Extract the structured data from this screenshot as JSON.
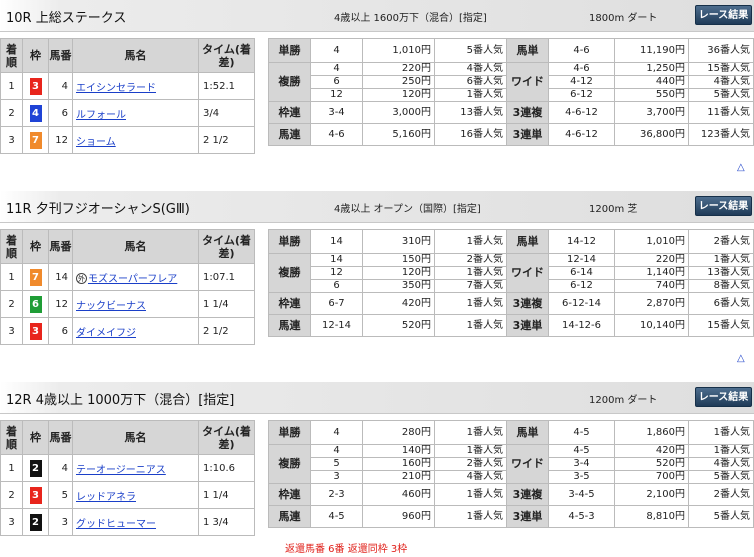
{
  "race_button_label": "レース結果",
  "colors": {
    "waku_1": "#ffffff",
    "waku_2": "#111111",
    "waku_3": "#e8251c",
    "waku_4": "#1f43d6",
    "waku_6": "#1f9d36",
    "waku_7": "#f08a2c",
    "link": "#1a3fc8",
    "note": "#e0201a"
  },
  "res_headers": [
    "着順",
    "枠",
    "馬番",
    "馬名",
    "タイム(着差)"
  ],
  "races": [
    {
      "title": "10R 上総ステークス",
      "condition": "4歳以上 1600万下（混合）[指定]",
      "distance": "1800m ダート",
      "results": [
        {
          "rank": "1",
          "waku": "3",
          "num": "4",
          "name": "エイシンセラード",
          "time": "1:52.1",
          "foreign": false
        },
        {
          "rank": "2",
          "waku": "4",
          "num": "6",
          "name": "ルフォール",
          "time": "3/4",
          "foreign": false
        },
        {
          "rank": "3",
          "waku": "7",
          "num": "12",
          "name": "ショーム",
          "time": "2 1/2",
          "foreign": false
        }
      ],
      "payouts": {
        "tansho": {
          "label": "単勝",
          "num": "4",
          "yen": "1,010円",
          "pop": "5番人気"
        },
        "fukusho": {
          "label": "複勝",
          "rows": [
            [
              "4",
              "220円",
              "4番人気"
            ],
            [
              "6",
              "250円",
              "6番人気"
            ],
            [
              "12",
              "120円",
              "1番人気"
            ]
          ]
        },
        "wakuren": {
          "label": "枠連",
          "num": "3-4",
          "yen": "3,000円",
          "pop": "13番人気"
        },
        "umaren": {
          "label": "馬連",
          "num": "4-6",
          "yen": "5,160円",
          "pop": "16番人気"
        },
        "umatan": {
          "label": "馬単",
          "num": "4-6",
          "yen": "11,190円",
          "pop": "36番人気"
        },
        "wide": {
          "label": "ワイド",
          "rows": [
            [
              "4-6",
              "1,250円",
              "15番人気"
            ],
            [
              "4-12",
              "440円",
              "4番人気"
            ],
            [
              "6-12",
              "550円",
              "5番人気"
            ]
          ]
        },
        "sanrenpuku": {
          "label": "3連複",
          "num": "4-6-12",
          "yen": "3,700円",
          "pop": "11番人気"
        },
        "sanrentan": {
          "label": "3連単",
          "num": "4-6-12",
          "yen": "36,800円",
          "pop": "123番人気"
        }
      }
    },
    {
      "title": "11R 夕刊フジオーシャンS(GⅢ)",
      "condition": "4歳以上 オープン（国際）[指定]",
      "distance": "1200m 芝",
      "results": [
        {
          "rank": "1",
          "waku": "7",
          "num": "14",
          "name": "モズスーパーフレア",
          "time": "1:07.1",
          "foreign": true,
          "foreign_mark": "外"
        },
        {
          "rank": "2",
          "waku": "6",
          "num": "12",
          "name": "ナックビーナス",
          "time": "1 1/4",
          "foreign": false
        },
        {
          "rank": "3",
          "waku": "3",
          "num": "6",
          "name": "ダイメイフジ",
          "time": "2 1/2",
          "foreign": false
        }
      ],
      "payouts": {
        "tansho": {
          "label": "単勝",
          "num": "14",
          "yen": "310円",
          "pop": "1番人気"
        },
        "fukusho": {
          "label": "複勝",
          "rows": [
            [
              "14",
              "150円",
              "2番人気"
            ],
            [
              "12",
              "120円",
              "1番人気"
            ],
            [
              "6",
              "350円",
              "7番人気"
            ]
          ]
        },
        "wakuren": {
          "label": "枠連",
          "num": "6-7",
          "yen": "420円",
          "pop": "1番人気"
        },
        "umaren": {
          "label": "馬連",
          "num": "12-14",
          "yen": "520円",
          "pop": "1番人気"
        },
        "umatan": {
          "label": "馬単",
          "num": "14-12",
          "yen": "1,010円",
          "pop": "2番人気"
        },
        "wide": {
          "label": "ワイド",
          "rows": [
            [
              "12-14",
              "220円",
              "1番人気"
            ],
            [
              "6-14",
              "1,140円",
              "13番人気"
            ],
            [
              "6-12",
              "740円",
              "8番人気"
            ]
          ]
        },
        "sanrenpuku": {
          "label": "3連複",
          "num": "6-12-14",
          "yen": "2,870円",
          "pop": "6番人気"
        },
        "sanrentan": {
          "label": "3連単",
          "num": "14-12-6",
          "yen": "10,140円",
          "pop": "15番人気"
        }
      }
    },
    {
      "title": "12R 4歳以上 1000万下（混合）[指定]",
      "condition": "",
      "distance": "1200m ダート",
      "results": [
        {
          "rank": "1",
          "waku": "2",
          "num": "4",
          "name": "テーオージーニアス",
          "time": "1:10.6",
          "foreign": false
        },
        {
          "rank": "2",
          "waku": "3",
          "num": "5",
          "name": "レッドアネラ",
          "time": "1 1/4",
          "foreign": false
        },
        {
          "rank": "3",
          "waku": "2",
          "num": "3",
          "name": "グッドヒューマー",
          "time": "1 3/4",
          "foreign": false
        }
      ],
      "payouts": {
        "tansho": {
          "label": "単勝",
          "num": "4",
          "yen": "280円",
          "pop": "1番人気"
        },
        "fukusho": {
          "label": "複勝",
          "rows": [
            [
              "4",
              "140円",
              "1番人気"
            ],
            [
              "5",
              "160円",
              "2番人気"
            ],
            [
              "3",
              "210円",
              "4番人気"
            ]
          ]
        },
        "wakuren": {
          "label": "枠連",
          "num": "2-3",
          "yen": "460円",
          "pop": "1番人気"
        },
        "umaren": {
          "label": "馬連",
          "num": "4-5",
          "yen": "960円",
          "pop": "1番人気"
        },
        "umatan": {
          "label": "馬単",
          "num": "4-5",
          "yen": "1,860円",
          "pop": "1番人気"
        },
        "wide": {
          "label": "ワイド",
          "rows": [
            [
              "4-5",
              "420円",
              "1番人気"
            ],
            [
              "3-4",
              "520円",
              "4番人気"
            ],
            [
              "3-5",
              "700円",
              "5番人気"
            ]
          ]
        },
        "sanrenpuku": {
          "label": "3連複",
          "num": "3-4-5",
          "yen": "2,100円",
          "pop": "2番人気"
        },
        "sanrentan": {
          "label": "3連単",
          "num": "4-5-3",
          "yen": "8,810円",
          "pop": "5番人気"
        }
      }
    }
  ],
  "refund_note": "返還馬番 6番 返還同枠 3枠",
  "top_arrow": "△"
}
